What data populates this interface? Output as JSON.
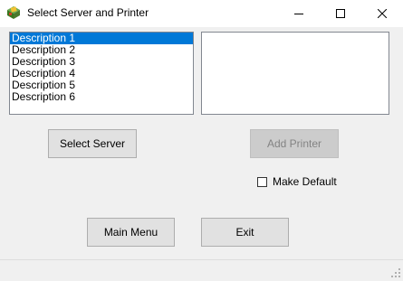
{
  "window": {
    "title": "Select Server and Printer",
    "icon": "printer-app-icon",
    "controls": [
      "minimize-icon",
      "maximize-icon",
      "close-icon"
    ]
  },
  "servers": {
    "items": [
      {
        "label": "Description 1",
        "selected": true
      },
      {
        "label": "Description 2",
        "selected": false
      },
      {
        "label": "Description 3",
        "selected": false
      },
      {
        "label": "Description 4",
        "selected": false
      },
      {
        "label": "Description 5",
        "selected": false
      },
      {
        "label": "Description 6",
        "selected": false
      }
    ]
  },
  "printers": {
    "items": []
  },
  "buttons": {
    "select_server": "Select Server",
    "add_printer": "Add Printer",
    "main_menu": "Main Menu",
    "exit": "Exit"
  },
  "make_default": {
    "label": "Make Default",
    "checked": false
  },
  "colors": {
    "selection": "#0078d7",
    "button_face": "#e1e1e1",
    "disabled_text": "#838383"
  }
}
